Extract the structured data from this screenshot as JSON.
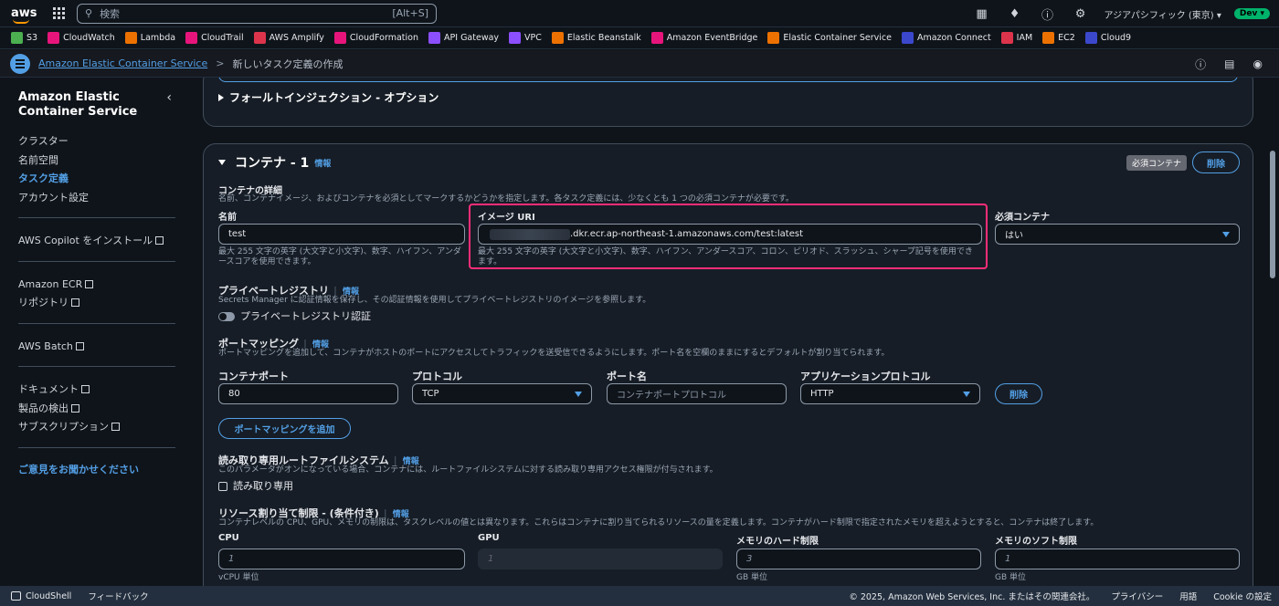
{
  "topbar": {
    "logo": "aws",
    "search_placeholder": "検索",
    "search_shortcut": "[Alt+S]",
    "region": "アジアパシフィック (東京) ▾",
    "account_badge": "Dev ▾"
  },
  "favorites": [
    {
      "label": "S3",
      "color": "#4caf50"
    },
    {
      "label": "CloudWatch",
      "color": "#e7157b"
    },
    {
      "label": "Lambda",
      "color": "#ed7100"
    },
    {
      "label": "CloudTrail",
      "color": "#e7157b"
    },
    {
      "label": "AWS Amplify",
      "color": "#dd344c"
    },
    {
      "label": "CloudFormation",
      "color": "#e7157b"
    },
    {
      "label": "API Gateway",
      "color": "#8c4fff"
    },
    {
      "label": "VPC",
      "color": "#8c4fff"
    },
    {
      "label": "Elastic Beanstalk",
      "color": "#ed7100"
    },
    {
      "label": "Amazon EventBridge",
      "color": "#e7157b"
    },
    {
      "label": "Elastic Container Service",
      "color": "#ed7100"
    },
    {
      "label": "Amazon Connect",
      "color": "#3b48cc"
    },
    {
      "label": "IAM",
      "color": "#dd344c"
    },
    {
      "label": "EC2",
      "color": "#ed7100"
    },
    {
      "label": "Cloud9",
      "color": "#3b48cc"
    }
  ],
  "breadcrumb": {
    "parent": "Amazon Elastic Container Service",
    "sep": ">",
    "current": "新しいタスク定義の作成"
  },
  "sidebar": {
    "title": "Amazon Elastic Container Service",
    "group1": [
      "クラスター",
      "名前空間",
      "タスク定義",
      "アカウント設定"
    ],
    "copilot": "AWS Copilot をインストール",
    "ecr": "Amazon ECR",
    "repo": "リポジトリ",
    "batch": "AWS Batch",
    "docs": "ドキュメント",
    "discover": "製品の検出",
    "subs": "サブスクリプション",
    "feedback": "ご意見をお聞かせください"
  },
  "fault_section": {
    "title": "フォールトインジェクション - オプション"
  },
  "container": {
    "title": "コンテナ - 1",
    "info": "情報",
    "required_badge": "必須コンテナ",
    "delete": "削除",
    "details_label": "コンテナの詳細",
    "details_desc": "名前、コンテナイメージ、およびコンテナを必須としてマークするかどうかを指定します。各タスク定義には、少なくとも 1 つの必須コンテナが必要です。",
    "name_label": "名前",
    "name_value": "test",
    "name_hint": "最大 255 文字の英字 (大文字と小文字)、数字、ハイフン、アンダースコアを使用できます。",
    "image_label": "イメージ URI",
    "image_value": ".dkr.ecr.ap-northeast-1.amazonaws.com/test:latest",
    "image_hint": "最大 255 文字の英字 (大文字と小文字)、数字、ハイフン、アンダースコア、コロン、ピリオド、スラッシュ、シャープ記号を使用できます。",
    "essential_label": "必須コンテナ",
    "essential_value": "はい",
    "registry_label": "プライベートレジストリ",
    "registry_info": "情報",
    "registry_desc": "Secrets Manager に認証情報を保存し、その認証情報を使用してプライベートレジストリのイメージを参照します。",
    "registry_toggle": "プライベートレジストリ認証",
    "port_label": "ポートマッピング",
    "port_info": "情報",
    "port_desc": "ポートマッピングを追加して、コンテナがホストのポートにアクセスしてトラフィックを送受信できるようにします。ポート名を空欄のままにするとデフォルトが割り当てられます。",
    "container_port_label": "コンテナポート",
    "container_port_value": "80",
    "protocol_label": "プロトコル",
    "protocol_value": "TCP",
    "port_name_label": "ポート名",
    "port_name_placeholder": "コンテナポートプロトコル",
    "app_protocol_label": "アプリケーションプロトコル",
    "app_protocol_value": "HTTP",
    "port_delete": "削除",
    "add_port": "ポートマッピングを追加",
    "rofs_label": "読み取り専用ルートファイルシステム",
    "rofs_info": "情報",
    "rofs_desc": "このパラメータがオンになっている場合、コンテナには、ルートファイルシステムに対する読み取り専用アクセス権限が付与されます。",
    "rofs_checkbox": "読み取り専用",
    "res_label": "リソース割り当て制限 - (条件付き)",
    "res_info": "情報",
    "res_desc": "コンテナレベルの CPU、GPU、メモリの制限は、タスクレベルの値とは異なります。これらはコンテナに割り当てられるリソースの量を定義します。コンテナがハード制限で指定されたメモリを超えようとすると、コンテナは終了します。",
    "cpu_label": "CPU",
    "cpu_placeholder": "1",
    "cpu_unit": "vCPU 単位",
    "gpu_label": "GPU",
    "gpu_placeholder": "1",
    "mem_hard_label": "メモリのハード制限",
    "mem_hard_placeholder": "3",
    "mem_hard_unit": "GB 単位",
    "mem_soft_label": "メモリのソフト制限",
    "mem_soft_placeholder": "1",
    "mem_soft_unit": "GB 単位"
  },
  "footer": {
    "cloudshell": "CloudShell",
    "feedback": "フィードバック",
    "copyright": "© 2025, Amazon Web Services, Inc. またはその関連会社。",
    "privacy": "プライバシー",
    "terms": "用語",
    "cookie": "Cookie の設定"
  }
}
